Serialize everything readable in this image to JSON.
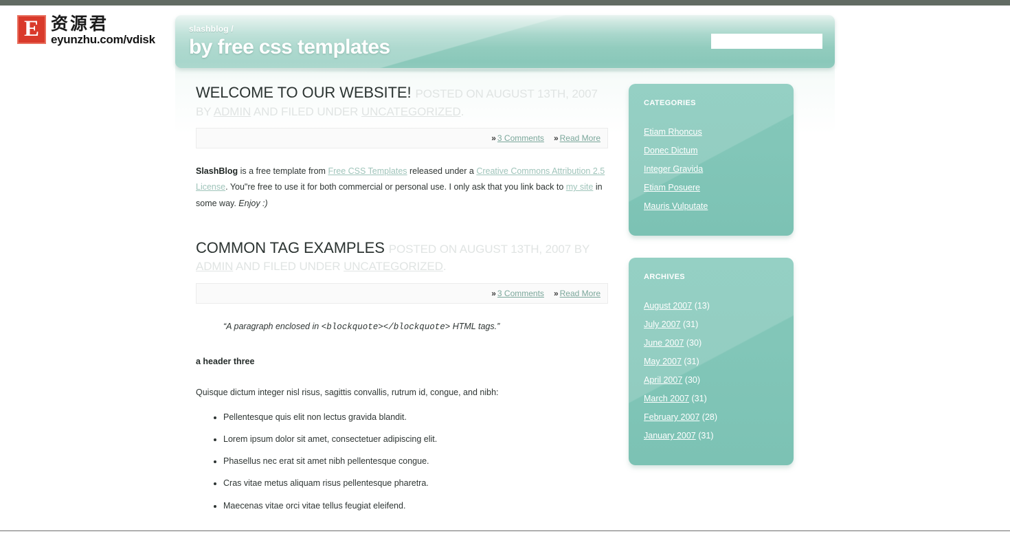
{
  "watermark": {
    "badge_letter": "E",
    "chinese": "资源君",
    "url": "eyunzhu.com/vdisk"
  },
  "header": {
    "subtitle": "slashblog /",
    "title": "by free css templates",
    "search_value": "",
    "search_placeholder": ""
  },
  "posts": [
    {
      "title": "WELCOME TO OUR WEBSITE!",
      "meta_prefix": "POSTED ON AUGUST 13TH, 2007 BY ",
      "meta_author": "ADMIN",
      "meta_middle": " AND FILED UNDER ",
      "meta_category": "UNCATEGORIZED",
      "meta_suffix": ".",
      "comments_label": "3 Comments",
      "readmore_label": "Read More",
      "chevron": "»",
      "body": {
        "lead_bold": "SlashBlog",
        "text_1": " is a free template from ",
        "link_1": "Free CSS Templates",
        "text_2": " released under a ",
        "link_2": "Creative Commons Attribution 2.5 License",
        "text_3": ". You\"re free to use it for both commercial or personal use. I only ask that you link back to ",
        "link_3": "my site",
        "text_4": " in some way. ",
        "emphasis": "Enjoy :)"
      }
    },
    {
      "title": "COMMON TAG EXAMPLES",
      "meta_prefix": "POSTED ON AUGUST 13TH, 2007 BY ",
      "meta_author": "ADMIN",
      "meta_middle": " AND FILED UNDER ",
      "meta_category": "UNCATEGORIZED",
      "meta_suffix": ".",
      "comments_label": "3 Comments",
      "readmore_label": "Read More",
      "chevron": "»",
      "blockquote_before": "“A paragraph enclosed in ",
      "blockquote_code": "<blockquote></blockquote>",
      "blockquote_after": " HTML tags.”",
      "header_three": "a header three",
      "intro": "Quisque dictum integer nisl risus, sagittis convallis, rutrum id, congue, and nibh:",
      "list": [
        "Pellentesque quis elit non lectus gravida blandit.",
        "Lorem ipsum dolor sit amet, consectetuer adipiscing elit.",
        "Phasellus nec erat sit amet nibh pellentesque congue.",
        "Cras vitae metus aliquam risus pellentesque pharetra.",
        "Maecenas vitae orci vitae tellus feugiat eleifend."
      ]
    }
  ],
  "sidebar": {
    "categories": {
      "title": "CATEGORIES",
      "items": [
        "Etiam Rhoncus",
        "Donec Dictum",
        "Integer Gravida",
        "Etiam Posuere",
        "Mauris Vulputate"
      ]
    },
    "archives": {
      "title": "ARCHIVES",
      "items": [
        {
          "label": "August 2007",
          "count": "(13)"
        },
        {
          "label": "July 2007",
          "count": "(31)"
        },
        {
          "label": "June 2007",
          "count": "(30)"
        },
        {
          "label": "May 2007",
          "count": "(31)"
        },
        {
          "label": "April 2007",
          "count": "(30)"
        },
        {
          "label": "March 2007",
          "count": "(31)"
        },
        {
          "label": "February 2007",
          "count": "(28)"
        },
        {
          "label": "January 2007",
          "count": "(31)"
        }
      ]
    }
  },
  "colors": {
    "accent_teal": "#84c8ba",
    "header_teal": "#92ccbe",
    "link_teal": "#7ba79b",
    "top_bar": "#626b63",
    "watermark_red": "#d93a2b"
  }
}
